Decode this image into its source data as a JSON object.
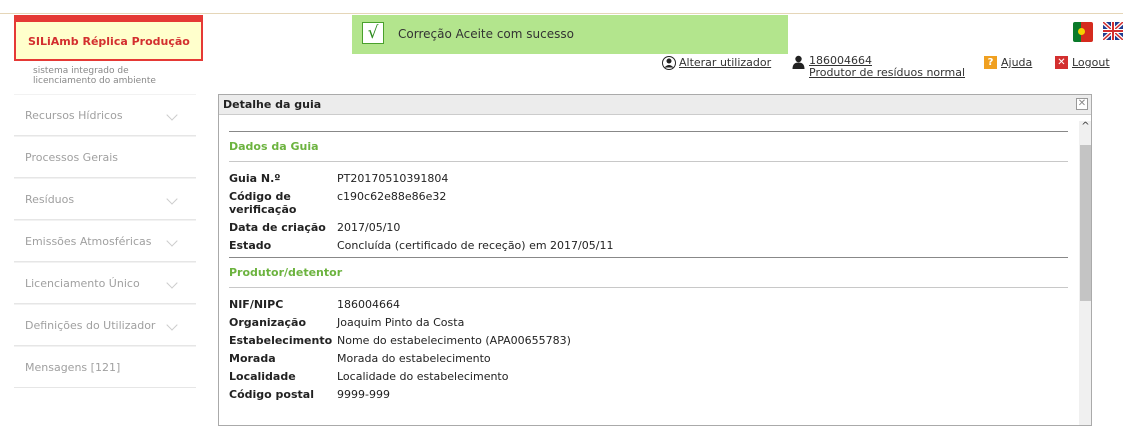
{
  "brand": {
    "title": "SILiAmb Réplica Produção",
    "subtitle": "sistema integrado de licenciamento do ambiente"
  },
  "notification": {
    "message": "Correção Aceite com sucesso",
    "icon": "check-icon",
    "color": "#b3e58d"
  },
  "header": {
    "change_user": "Alterar utilizador",
    "user_id": "186004664",
    "user_role": "Produtor de resíduos normal",
    "help": "Ajuda",
    "logout": "Logout"
  },
  "sidebar": {
    "items": [
      {
        "label": "Recursos Hídricos",
        "has_chevron": true
      },
      {
        "label": "Processos Gerais",
        "has_chevron": false
      },
      {
        "label": "Resíduos",
        "has_chevron": true
      },
      {
        "label": "Emissões Atmosféricas",
        "has_chevron": true
      },
      {
        "label": "Licenciamento Único",
        "has_chevron": true
      },
      {
        "label": "Definições do Utilizador",
        "has_chevron": true
      },
      {
        "label": "Mensagens [121]",
        "has_chevron": false
      }
    ]
  },
  "modal": {
    "title": "Detalhe da guia",
    "sections": {
      "guia": {
        "title": "Dados da Guia",
        "rows": [
          {
            "label": "Guia N.º",
            "value": "PT20170510391804"
          },
          {
            "label": "Código de verificação",
            "value": "c190c62e88e86e32"
          },
          {
            "label": "Data de criação",
            "value": "2017/05/10"
          },
          {
            "label": "Estado",
            "value": "Concluída (certificado de receção) em 2017/05/11"
          }
        ]
      },
      "produtor": {
        "title": "Produtor/detentor",
        "rows": [
          {
            "label": "NIF/NIPC",
            "value": "186004664"
          },
          {
            "label": "Organização",
            "value": "Joaquim Pinto da Costa"
          },
          {
            "label": "Estabelecimento",
            "value": "Nome do estabelecimento (APA00655783)"
          },
          {
            "label": "Morada",
            "value": "Morada do estabelecimento"
          },
          {
            "label": "Localidade",
            "value": "Localidade do estabelecimento"
          },
          {
            "label": "Código postal",
            "value": "9999-999"
          }
        ]
      }
    }
  },
  "colors": {
    "accent_green": "#6cb33f",
    "brand_red": "#e53935"
  }
}
